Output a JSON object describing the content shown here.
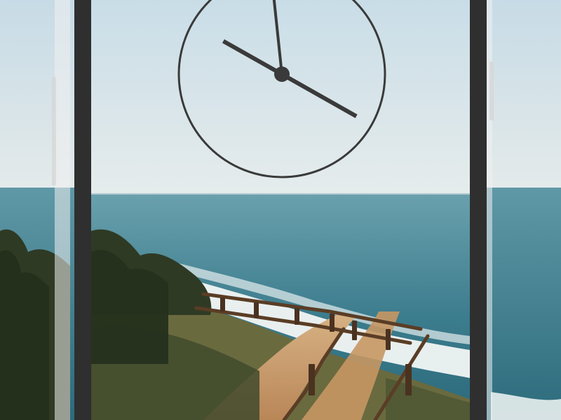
{
  "wallpaper": {
    "scene": "coastal-cliff-staircase",
    "colors": {
      "sky_top": "#cfe0ea",
      "sky_horizon": "#e6ecec",
      "sea_far": "#5d97a6",
      "sea_near": "#2f6f80",
      "surf": "#f1f4f2",
      "sand": "#c99a66",
      "scrub": "#4f5a36",
      "tree": "#2f3a24",
      "rail": "#5a3d25"
    }
  },
  "device": {
    "bezel_color": "#2f2f2f",
    "side_button_color": "#c9c9c9"
  },
  "clock": {
    "hour": 3,
    "minute": 59,
    "second": 0,
    "face_stroke": "#3a3a3a",
    "hand_color": "#3a3a3a"
  }
}
